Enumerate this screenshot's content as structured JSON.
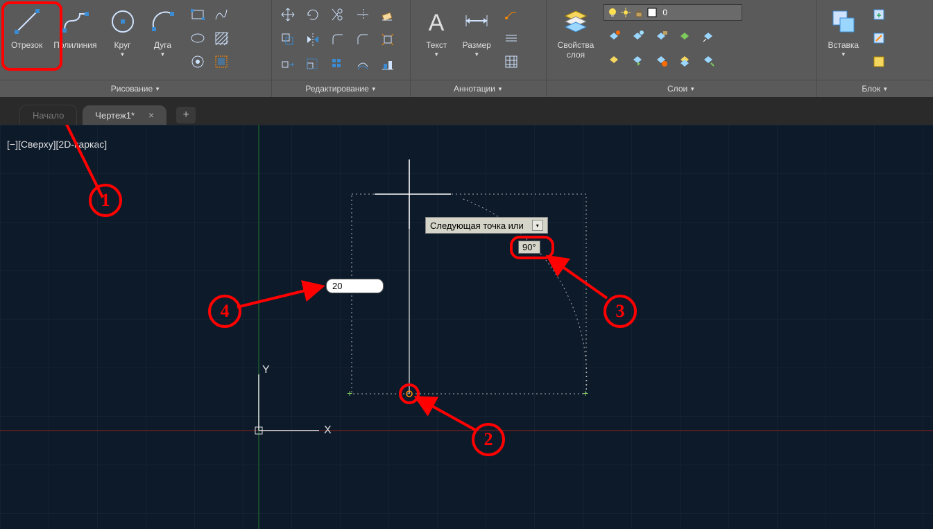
{
  "ribbon": {
    "draw": {
      "title": "Рисование",
      "line": "Отрезок",
      "polyline": "Полилиния",
      "circle": "Круг",
      "arc": "Дуга"
    },
    "modify": {
      "title": "Редактирование"
    },
    "annotation": {
      "title": "Аннотации",
      "text": "Текст",
      "dim": "Размер"
    },
    "layers": {
      "title": "Слои",
      "props": "Свойства\nслоя",
      "current": "0"
    },
    "block": {
      "title": "Блок",
      "insert": "Вставка"
    }
  },
  "tabs": {
    "start": "Начало",
    "drawing": "Чертеж1*"
  },
  "viewport": {
    "label": "[−][Сверху][2D-каркас]"
  },
  "dyninput": {
    "prompt": "Следующая точка или",
    "angle": "90°",
    "length": "20"
  },
  "annotations": {
    "c1": "1",
    "c2": "2",
    "c3": "3",
    "c4": "4"
  }
}
